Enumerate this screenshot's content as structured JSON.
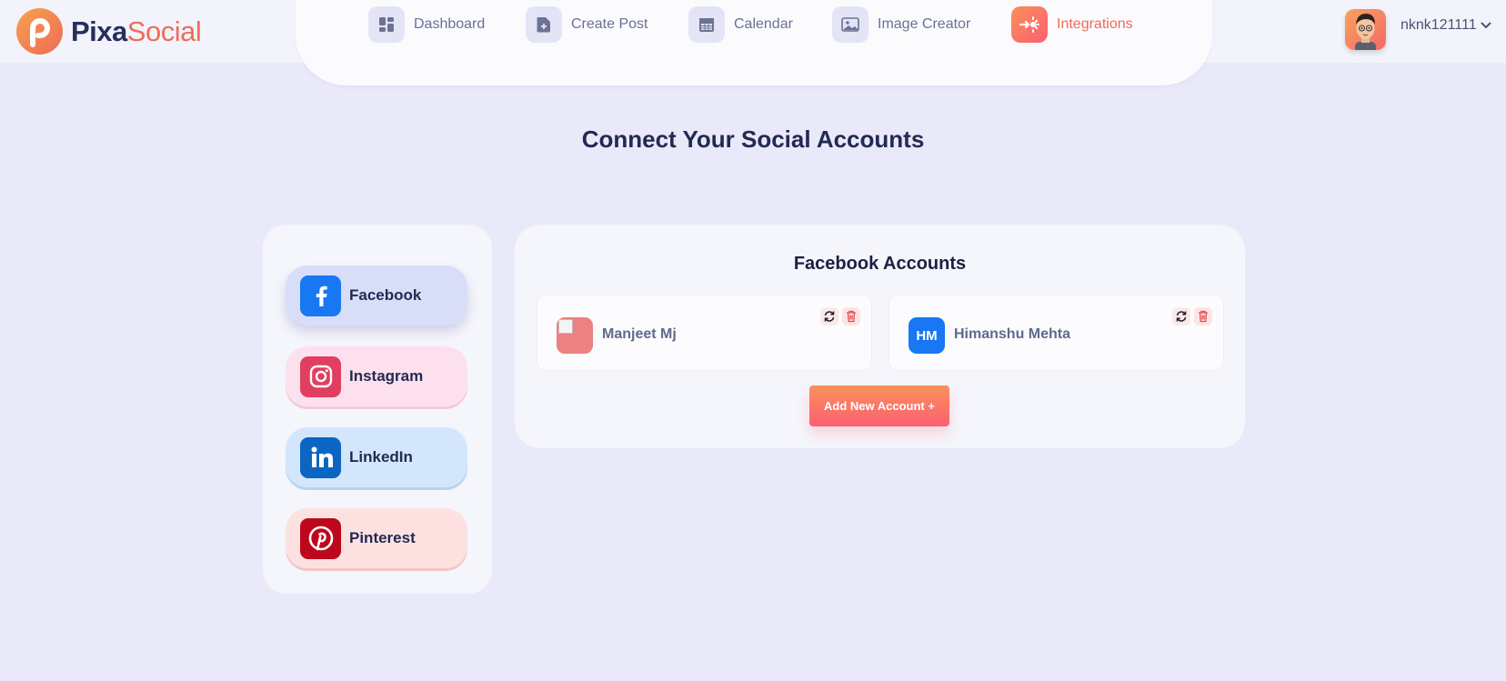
{
  "brand": {
    "name_part1": "Pixa",
    "name_part2": "Social"
  },
  "nav": {
    "items": [
      {
        "label": "Dashboard",
        "icon": "dashboard-icon",
        "active": false
      },
      {
        "label": "Create Post",
        "icon": "create-post-icon",
        "active": false
      },
      {
        "label": "Calendar",
        "icon": "calendar-icon",
        "active": false
      },
      {
        "label": "Image Creator",
        "icon": "image-icon",
        "active": false
      },
      {
        "label": "Integrations",
        "icon": "integrations-icon",
        "active": true
      }
    ]
  },
  "user": {
    "name": "nknk121111"
  },
  "page": {
    "title": "Connect Your Social Accounts"
  },
  "platforms": [
    {
      "label": "Facebook",
      "icon": "facebook-icon",
      "color": "#1877f2",
      "selected": true
    },
    {
      "label": "Instagram",
      "icon": "instagram-icon",
      "color": "#e1306c",
      "selected": false
    },
    {
      "label": "LinkedIn",
      "icon": "linkedin-icon",
      "color": "#0a66c2",
      "selected": false
    },
    {
      "label": "Pinterest",
      "icon": "pinterest-icon",
      "color": "#bd081c",
      "selected": false
    }
  ],
  "accounts": {
    "title": "Facebook Accounts",
    "items": [
      {
        "name": "Manjeet Mj",
        "initials": ""
      },
      {
        "name": "Himanshu Mehta",
        "initials": "HM"
      }
    ],
    "add_button": "Add New Account +"
  },
  "colors": {
    "accent": "#ef6a5a",
    "background": "#e9e9fa",
    "navy": "#232a52"
  }
}
